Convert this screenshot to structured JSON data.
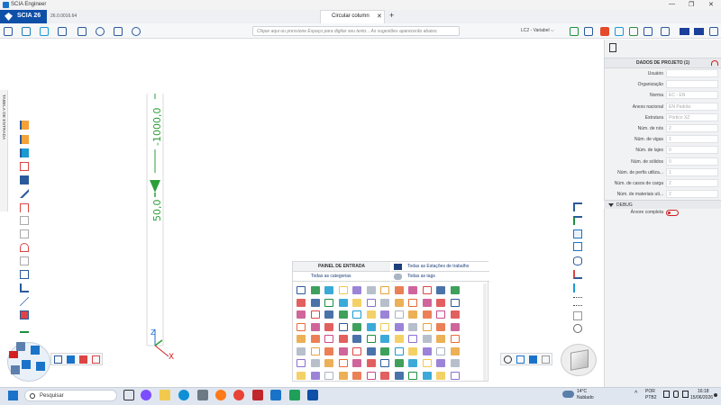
{
  "window": {
    "title": "SCIA Engineer",
    "controls": [
      "—",
      "❐",
      "✕"
    ]
  },
  "app": {
    "name": "SCIA 26",
    "version": "26.0.0016.64"
  },
  "document_tab": {
    "label": "Circular column",
    "close": "✕",
    "add": "+"
  },
  "command_line": {
    "placeholder": "Clique aqui ou pressione Espaço para digitar seu texto... As sugestões aparecerão abaixo."
  },
  "load_case": {
    "value": "LC2 - Variabel",
    "chevron": "⌵"
  },
  "left_tab": {
    "label": "TABELA DE ENTRADA"
  },
  "viewport": {
    "dim_top": "-1000,0",
    "dim_bottom": "50,0",
    "axis_x": "X",
    "axis_z": "Z"
  },
  "project_panel": {
    "title": "DADOS DE PROJETO (1)",
    "rows": [
      {
        "label": "Usuário",
        "value": ""
      },
      {
        "label": "Organização",
        "value": ""
      },
      {
        "label": "Norma",
        "value": "EC - EN"
      },
      {
        "label": "Anexo nacional",
        "value": "EN Padrão"
      },
      {
        "label": "Estrutura",
        "value": "Pórtico XZ"
      },
      {
        "label": "Núm. de nós",
        "value": "2"
      },
      {
        "label": "Núm. de vigas",
        "value": "1"
      },
      {
        "label": "Núm. de lajes",
        "value": "0"
      },
      {
        "label": "Núm. de sólidos",
        "value": "0"
      },
      {
        "label": "Núm. de perfis utiliza...",
        "value": "1"
      },
      {
        "label": "Núm. de casos de carga",
        "value": "2"
      },
      {
        "label": "Núm. de materiais uti...",
        "value": "2"
      }
    ],
    "debug_label": "DEBUG",
    "tree_label": "Árvore completa"
  },
  "input_panel": {
    "title": "PAINEL DE ENTRADA",
    "categories": "Todas as categorias",
    "workstations": "Todas as Estações de trabalho",
    "tags": "Todas as tags"
  },
  "taskbar": {
    "search_placeholder": "Pesquisar",
    "weather_temp": "14°C",
    "weather_text": "Nublado",
    "lang": "POR",
    "lang2": "PTB2",
    "time": "16:18",
    "date": "15/06/2026"
  },
  "colors": {
    "accent": "#0e4fa8",
    "dim_green": "#2e9e3a",
    "axis_red": "#d22020"
  }
}
